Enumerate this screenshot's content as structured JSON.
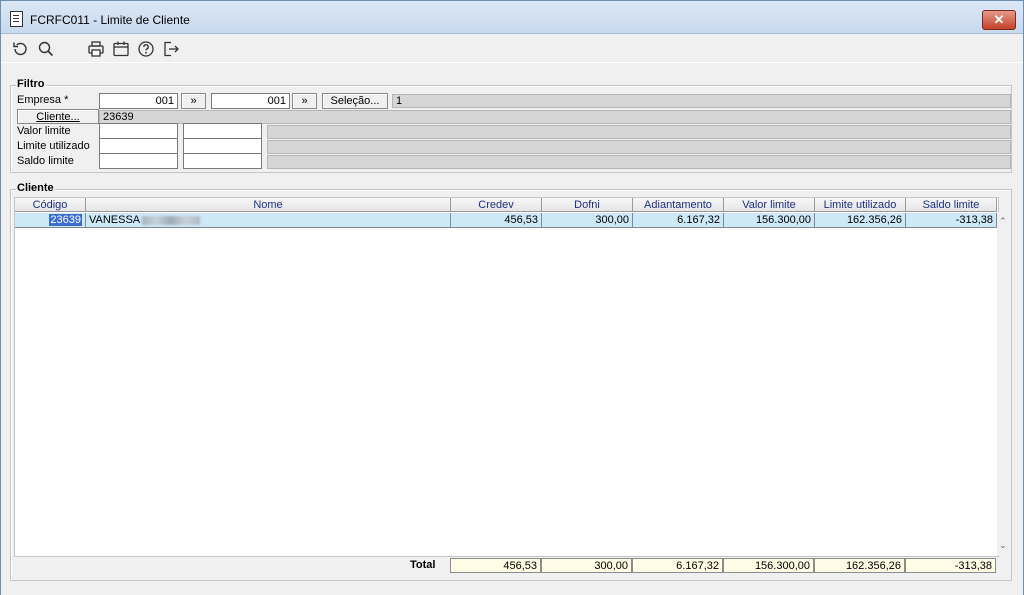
{
  "window": {
    "title": "FCRFC011 - Limite de Cliente",
    "close_label": "✕"
  },
  "toolbar": {
    "icons": [
      "undo-icon",
      "search-icon",
      "print-icon",
      "calendar-icon",
      "help-icon",
      "exit-icon"
    ]
  },
  "filtro": {
    "legend": "Filtro",
    "empresa_label": "Empresa *",
    "empresa_from": "001",
    "empresa_from_btn": "»",
    "empresa_to": "001",
    "empresa_to_btn": "»",
    "selecao_label": "Seleção...",
    "selecao_value": "1",
    "cliente_btn": "Cliente...",
    "cliente_value": "23639",
    "valor_limite_label": "Valor limite",
    "limite_utilizado_label": "Limite utilizado",
    "saldo_limite_label": "Saldo limite"
  },
  "cliente": {
    "legend": "Cliente",
    "columns": [
      "Código",
      "Nome",
      "Credev",
      "Dofni",
      "Adiantamento",
      "Valor limite",
      "Limite utilizado",
      "Saldo limite"
    ],
    "rows": [
      {
        "codigo": "23639",
        "nome": "VANESSA",
        "credev": "456,53",
        "dofni": "300,00",
        "adiantamento": "6.167,32",
        "valor_limite": "156.300,00",
        "limite_utilizado": "162.356,26",
        "saldo_limite": "-313,38"
      }
    ],
    "total_label": "Total",
    "totals": {
      "credev": "456,53",
      "dofni": "300,00",
      "adiantamento": "6.167,32",
      "valor_limite": "156.300,00",
      "limite_utilizado": "162.356,26",
      "saldo_limite": "-313,38"
    }
  }
}
